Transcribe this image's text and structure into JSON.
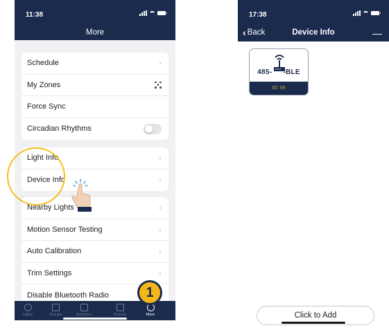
{
  "left": {
    "status_time": "11:38",
    "title": "More",
    "group1": [
      {
        "label": "Schedule",
        "accessory": "chevron"
      },
      {
        "label": "My Zones",
        "accessory": "qr"
      },
      {
        "label": "Force Sync",
        "accessory": "none"
      },
      {
        "label": "Circadian Rhythms",
        "accessory": "toggle",
        "toggle_on": false
      }
    ],
    "group2": [
      {
        "label": "Light Info",
        "accessory": "chevron"
      },
      {
        "label": "Device Info",
        "accessory": "chevron"
      }
    ],
    "group3": [
      {
        "label": "Nearby Lights",
        "accessory": "chevron"
      },
      {
        "label": "Motion Sensor Testing",
        "accessory": "chevron"
      },
      {
        "label": "Auto Calibration",
        "accessory": "chevron"
      },
      {
        "label": "Trim Settings",
        "accessory": "chevron"
      },
      {
        "label": "Disable Bluetooth Radio",
        "accessory": "none"
      }
    ],
    "tabs": [
      "Lights",
      "Groups",
      "Switches",
      "Scenes",
      "More"
    ],
    "active_tab": "More",
    "step_badge": "1"
  },
  "right": {
    "status_time": "17:38",
    "back_label": "Back",
    "title": "Device Info",
    "minus": "—",
    "device": {
      "name": "485-BLE",
      "name_left": "485-",
      "name_right": "-BLE",
      "id": "ID: 59"
    },
    "add_button": "Click to Add"
  },
  "colors": {
    "header": "#1b2b4d",
    "highlight": "#f5be1d",
    "id_text": "#d4a93a"
  }
}
